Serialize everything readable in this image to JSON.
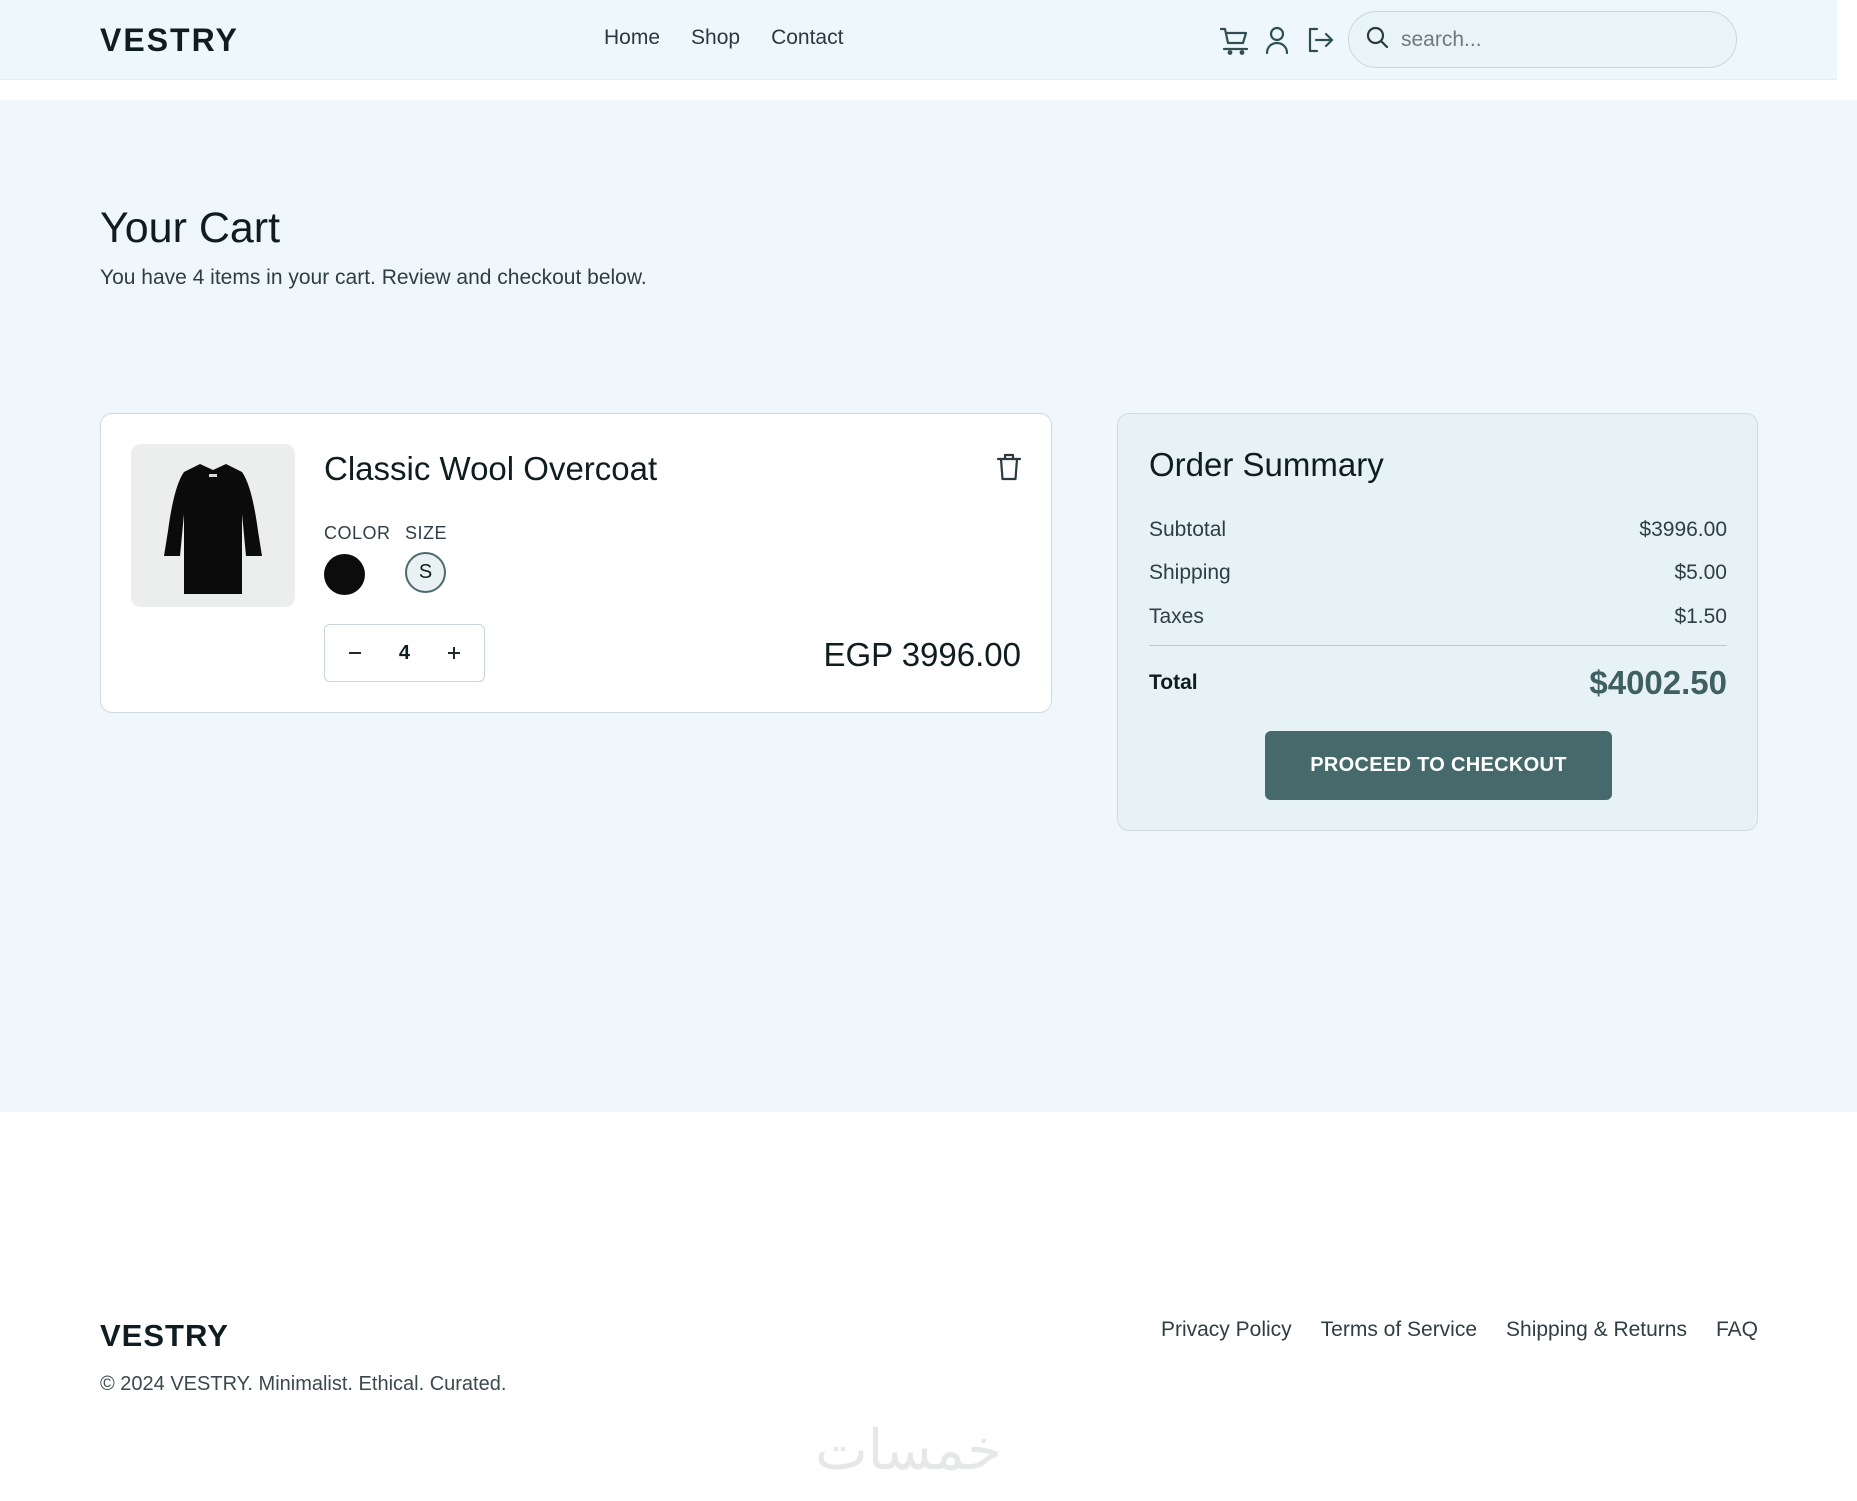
{
  "header": {
    "logo": "VESTRY",
    "nav": [
      {
        "label": "Home"
      },
      {
        "label": "Shop"
      },
      {
        "label": "Contact"
      }
    ],
    "icons": [
      "cart-icon",
      "user-icon",
      "logout-icon",
      "search-icon"
    ],
    "search": {
      "placeholder": "search...",
      "value": ""
    }
  },
  "cart": {
    "title": "Your Cart",
    "subtitle": "You have 4 items in your cart. Review and checkout below.",
    "items": [
      {
        "name": "Classic Wool Overcoat",
        "color_label": "COLOR",
        "size_label": "SIZE",
        "color": "#0c0c0c",
        "size": "S",
        "quantity": "4",
        "price": "EGP 3996.00"
      }
    ]
  },
  "summary": {
    "title": "Order Summary",
    "rows": [
      {
        "label": "Subtotal",
        "value": "$3996.00"
      },
      {
        "label": "Shipping",
        "value": "$5.00"
      },
      {
        "label": "Taxes",
        "value": "$1.50"
      }
    ],
    "total_label": "Total",
    "total_value": "$4002.50",
    "checkout_label": "PROCEED TO CHECKOUT"
  },
  "footer": {
    "logo": "VESTRY",
    "copyright": "© 2024 VESTRY. Minimalist. Ethical. Curated.",
    "links": [
      {
        "label": "Privacy Policy"
      },
      {
        "label": "Terms of Service"
      },
      {
        "label": "Shipping & Returns"
      },
      {
        "label": "FAQ"
      }
    ],
    "watermark": "خمسات"
  },
  "colors": {
    "header_bg": "#eef7fb",
    "main_bg": "#eff7fb",
    "accent": "#466a6c",
    "total_text": "#3f5f63"
  }
}
